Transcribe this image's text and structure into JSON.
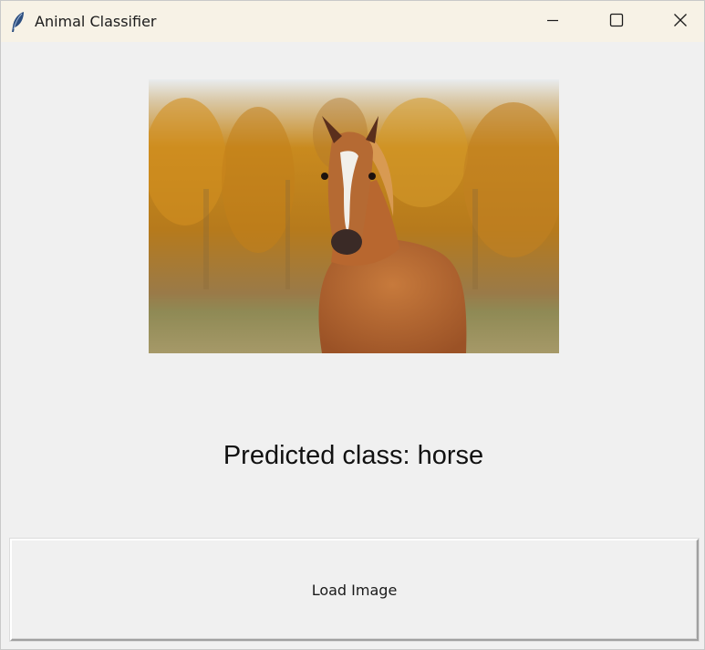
{
  "window": {
    "title": "Animal Classifier",
    "icon": "feather-icon",
    "controls": {
      "minimize_icon": "minimize-icon",
      "maximize_icon": "maximize-icon",
      "close_icon": "close-icon"
    }
  },
  "main": {
    "image": {
      "subject": "horse",
      "colors": {
        "sky": "#e9ecee",
        "foliage": "#c98a1e",
        "grass": "#8f8a55",
        "coat": "#b8672f"
      }
    },
    "prediction_text": "Predicted class: horse",
    "load_button_label": "Load Image"
  }
}
